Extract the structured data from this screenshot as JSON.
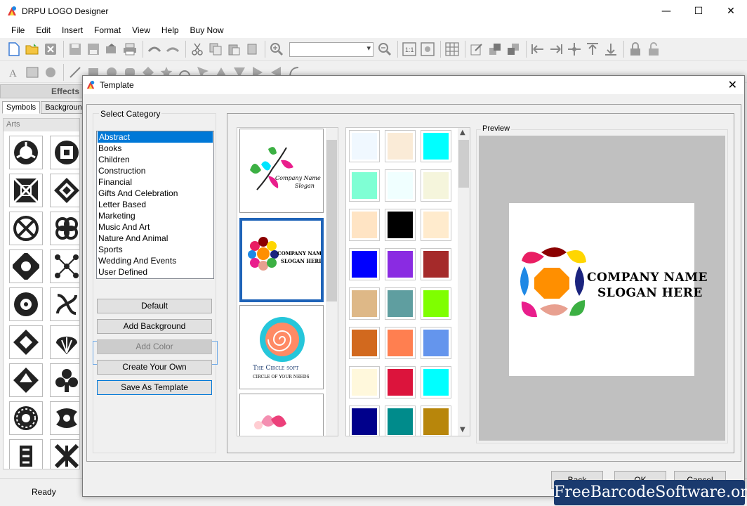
{
  "window": {
    "title": "DRPU LOGO Designer",
    "minimize": "—",
    "maximize": "☐",
    "close": "✕"
  },
  "menu": [
    "File",
    "Edit",
    "Insert",
    "Format",
    "View",
    "Help",
    "Buy Now"
  ],
  "left_panel": {
    "effects": "Effects",
    "tabs": [
      "Symbols",
      "Backgroun"
    ],
    "arts_label": "Arts"
  },
  "status": "Ready",
  "dialog": {
    "title": "Template",
    "close": "✕",
    "select_category": "Select Category",
    "categories": [
      "Abstract",
      "Books",
      "Children",
      "Construction",
      "Financial",
      "Gifts And Celebration",
      "Letter Based",
      "Marketing",
      "Music And Art",
      "Nature And Animal",
      "Sports",
      "Wedding And Events",
      "User Defined"
    ],
    "selected_category": "Abstract",
    "buttons": {
      "default": "Default",
      "add_background": "Add Background",
      "add_color": "Add Color",
      "create_your_own": "Create Your Own",
      "save_as_template": "Save As Template",
      "back": "Back",
      "ok": "OK",
      "cancel": "Cancel"
    },
    "templates": [
      {
        "line1": "Company Name",
        "line2": "Slogan"
      },
      {
        "line1": "COMPANY NAME",
        "line2": "SLOGAN HERE"
      },
      {
        "line1": "The Circle soft",
        "line2": "CIRCLE OF YOUR NEEDS"
      },
      {
        "line1": "",
        "line2": ""
      }
    ],
    "swatches": [
      "#f0f8ff",
      "#faebd7",
      "#00ffff",
      "#7fffd4",
      "#f0ffff",
      "#f5f5dc",
      "#ffe4c4",
      "#000000",
      "#ffebcd",
      "#0000ff",
      "#8a2be2",
      "#a52a2a",
      "#deb887",
      "#5f9ea0",
      "#7fff00",
      "#d2691e",
      "#ff7f50",
      "#6495ed",
      "#fff8dc",
      "#dc143c",
      "#00ffff",
      "#00008b",
      "#008b8b",
      "#b8860b"
    ],
    "preview": {
      "label": "Preview",
      "company": "COMPANY NAME",
      "slogan": "SLOGAN HERE"
    }
  },
  "watermark": "FreeBarcodeSoftware.org"
}
